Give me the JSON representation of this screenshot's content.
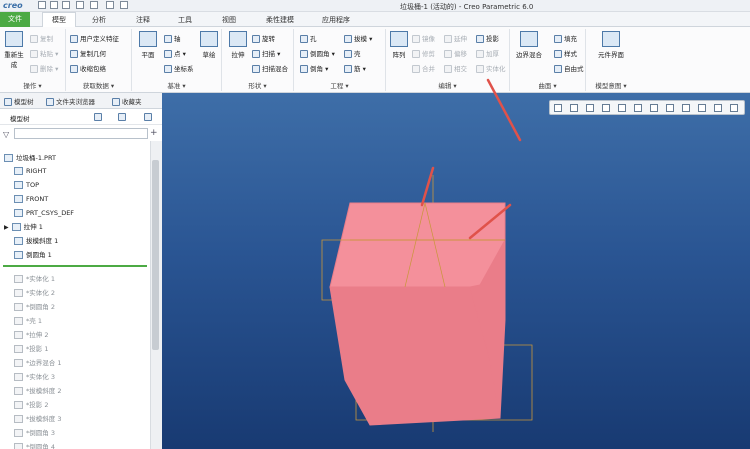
{
  "app": {
    "logo": "creo",
    "window_title": "垃圾桶-1 (活动的) - Creo Parametric 6.0"
  },
  "tabs": [
    {
      "label": "文件"
    },
    {
      "label": "模型"
    },
    {
      "label": "分析"
    },
    {
      "label": "注释"
    },
    {
      "label": "工具"
    },
    {
      "label": "视图"
    },
    {
      "label": "柔性建模"
    },
    {
      "label": "应用程序"
    }
  ],
  "ribbon": {
    "operations": {
      "label": "操作 ▾",
      "regen": "重新生成",
      "copy": "复制",
      "paste": "粘贴 ▾",
      "delete": "删除 ▾"
    },
    "get_data": {
      "label": "获取数据 ▾",
      "user_feature": "用户定义特征",
      "copy_geom": "复制几何",
      "shrinkwrap": "收缩包络"
    },
    "datum": {
      "label": "基准 ▾",
      "plane": "平面",
      "axis": "轴",
      "point": "点 ▾",
      "csys": "坐标系",
      "sketch": "草绘"
    },
    "shapes": {
      "label": "形状 ▾",
      "extrude": "拉伸",
      "revolve": "旋转",
      "sweep": "扫描 ▾",
      "swept_blend": "扫描混合"
    },
    "engineering": {
      "label": "工程 ▾",
      "hole": "孔",
      "round": "倒圆角 ▾",
      "chamfer": "倒角 ▾",
      "draft": "拔模 ▾",
      "shell": "壳",
      "rib": "筋 ▾"
    },
    "editing": {
      "label": "编辑 ▾",
      "pattern": "阵列",
      "mirror": "镜像",
      "trim": "修剪",
      "offset": "偏移",
      "extend": "延伸",
      "intersect": "相交",
      "thicken": "加厚",
      "merge": "合并",
      "project": "投影",
      "solidify": "实体化"
    },
    "surfaces": {
      "label": "曲面 ▾",
      "boundary": "边界混合",
      "fill": "填充",
      "style": "样式",
      "freestyle": "自由式"
    },
    "model_intent": {
      "label": "模型意图 ▾",
      "component_interface": "元件界面"
    }
  },
  "left_tabs": {
    "model_tree": "模型树",
    "file_browser": "文件夹浏览器",
    "favorites": "收藏夹"
  },
  "tree": {
    "header": "模型树",
    "root": "垃圾桶-1.PRT",
    "items": [
      {
        "label": "RIGHT"
      },
      {
        "label": "TOP"
      },
      {
        "label": "FRONT"
      },
      {
        "label": "PRT_CSYS_DEF"
      },
      {
        "label": "拉伸 1"
      },
      {
        "label": "拔模斜度 1"
      },
      {
        "label": "倒圆角 1"
      }
    ],
    "suppressed": [
      {
        "label": "*实体化 1"
      },
      {
        "label": "*实体化 2"
      },
      {
        "label": "*倒圆角 2"
      },
      {
        "label": "*壳 1"
      },
      {
        "label": "*拉伸 2"
      },
      {
        "label": "*投影 1"
      },
      {
        "label": "*边界混合 1"
      },
      {
        "label": "*实体化 3"
      },
      {
        "label": "*拔模斜度 2"
      },
      {
        "label": "*投影 2"
      },
      {
        "label": "*拔模斜度 3"
      },
      {
        "label": "*倒圆角 3"
      },
      {
        "label": "*倒圆角 4"
      }
    ]
  },
  "colors": {
    "file_tab": "#4caa44",
    "model_fill": "#ea7d89",
    "model_top": "#f4909b",
    "datum_line": "#c9963a",
    "arrow": "#e0524a"
  }
}
